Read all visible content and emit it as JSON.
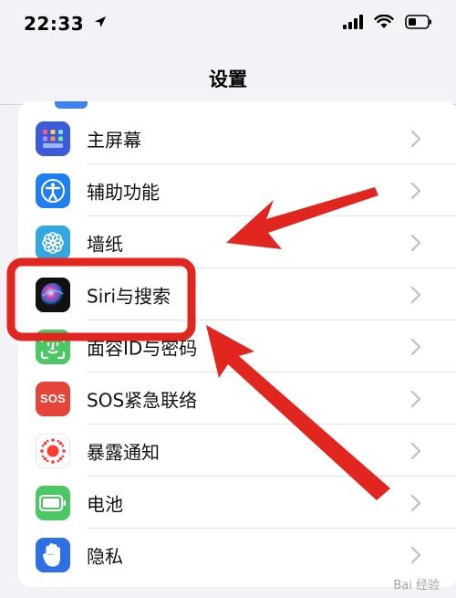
{
  "status_bar": {
    "time": "22:33",
    "location_icon": "location-arrow-icon",
    "signal_icon": "cellular-signal-icon",
    "wifi_icon": "wifi-icon",
    "battery_icon": "battery-icon"
  },
  "nav": {
    "title": "设置"
  },
  "settings": {
    "items": [
      {
        "label": "主屏幕",
        "icon": "home-screen-grid-icon",
        "color": "#3b5bdb"
      },
      {
        "label": "辅助功能",
        "icon": "accessibility-person-icon",
        "color": "#1f7ff0"
      },
      {
        "label": "墙纸",
        "icon": "wallpaper-flower-icon",
        "color": "#35a7e0"
      },
      {
        "label": "Siri与搜索",
        "icon": "siri-orb-icon",
        "color": "#1a1a2e"
      },
      {
        "label": "面容ID与密码",
        "icon": "face-id-icon",
        "color": "#4cc764"
      },
      {
        "label": "SOS紧急联络",
        "icon": "sos-icon",
        "color": "#e5443a",
        "icon_text": "SOS"
      },
      {
        "label": "暴露通知",
        "icon": "exposure-notification-icon",
        "color": "#ffffff"
      },
      {
        "label": "电池",
        "icon": "battery-setting-icon",
        "color": "#4cc764"
      },
      {
        "label": "隐私",
        "icon": "privacy-hand-icon",
        "color": "#2f6fe6"
      }
    ]
  },
  "annotation": {
    "highlight_color": "#e0261f"
  },
  "watermark": {
    "text": "Bai 经验"
  }
}
